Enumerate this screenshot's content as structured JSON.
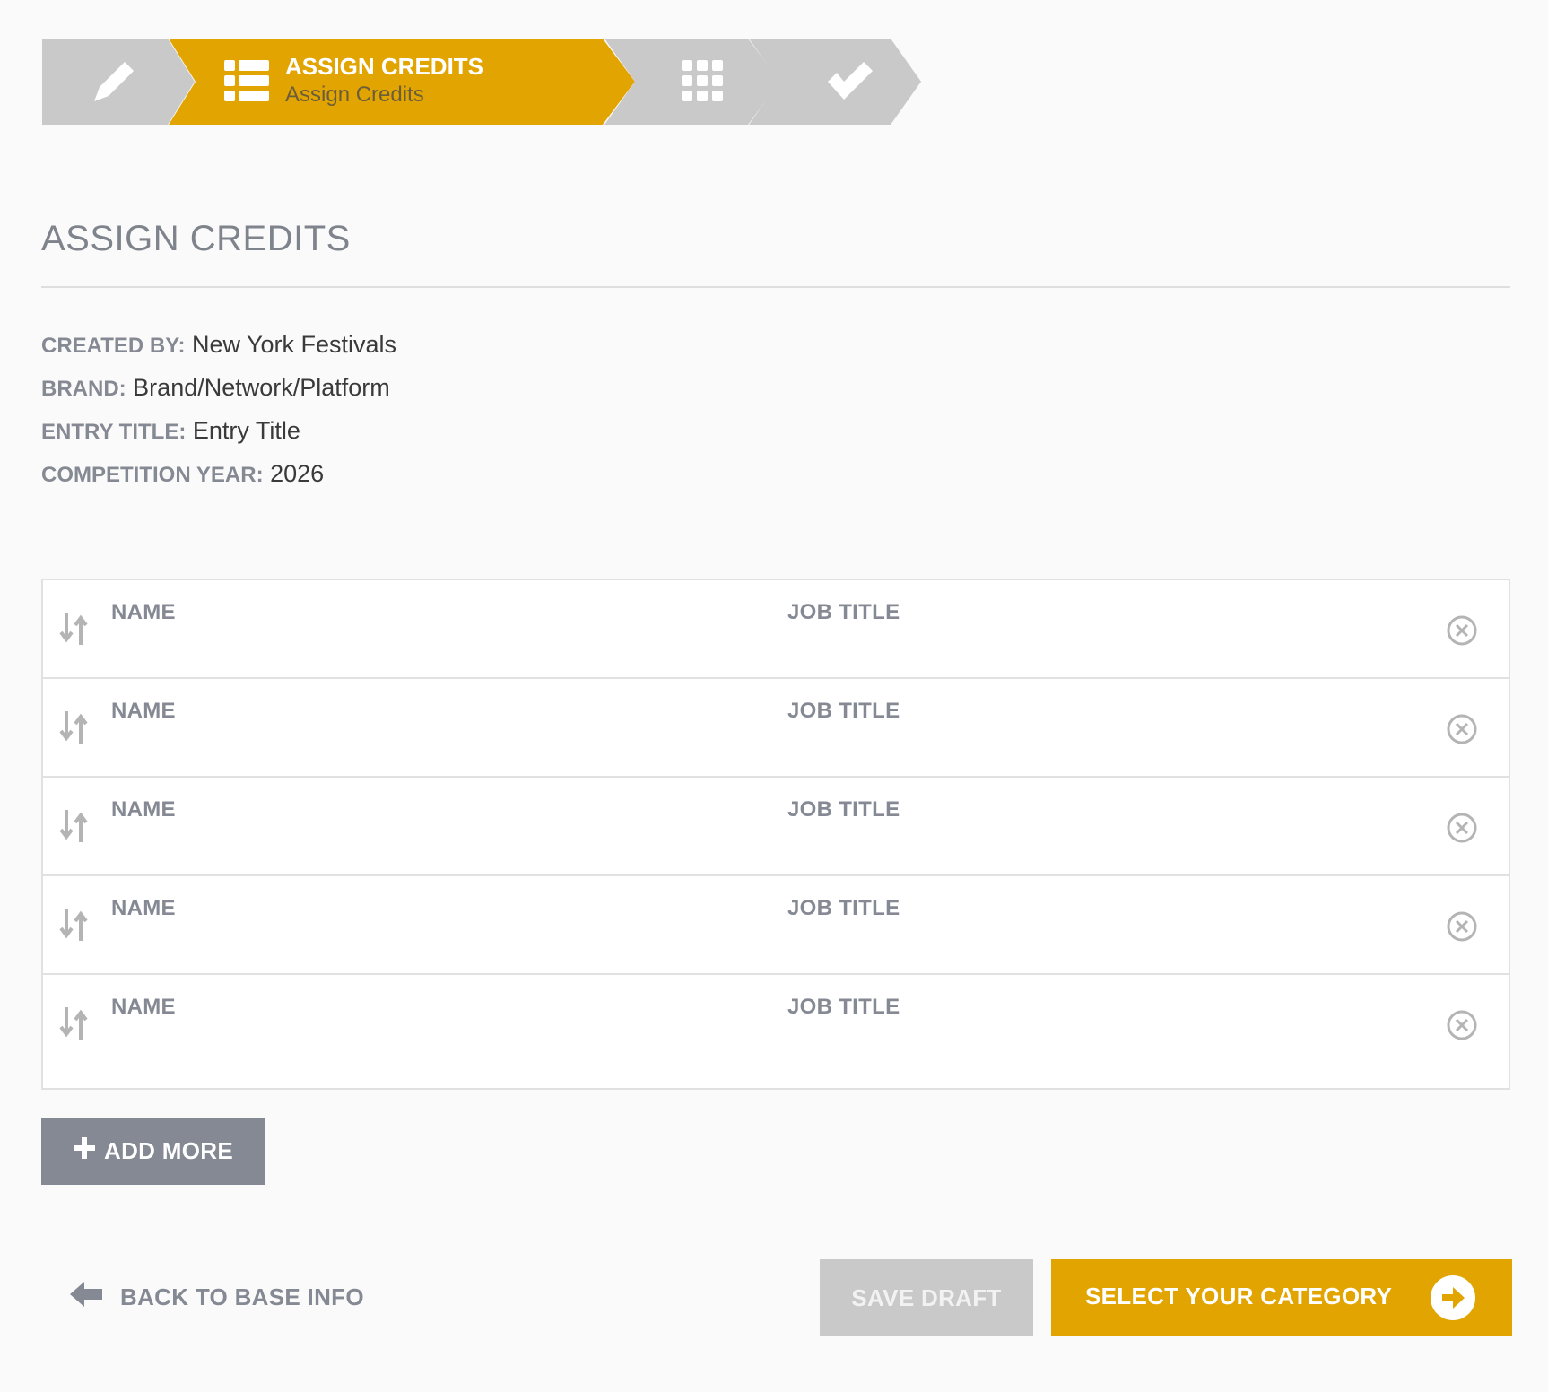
{
  "wizard": {
    "active_title": "ASSIGN CREDITS",
    "active_subtitle": "Assign Credits",
    "steps": [
      "pencil-icon",
      "list-icon",
      "grid-icon",
      "check-icon"
    ],
    "active_color": "#e2a400",
    "inactive_color": "#c9c9c9"
  },
  "page": {
    "title": "ASSIGN CREDITS"
  },
  "meta": {
    "created_by_label": "CREATED BY:",
    "created_by_value": "New York Festivals",
    "brand_label": "BRAND:",
    "brand_value": "Brand/Network/Platform",
    "entry_title_label": "ENTRY TITLE:",
    "entry_title_value": "Entry Title",
    "year_label": "COMPETITION YEAR:",
    "year_value": "2026"
  },
  "credits": {
    "name_label": "NAME",
    "job_label": "JOB TITLE",
    "rows": [
      {
        "name": "",
        "job": ""
      },
      {
        "name": "",
        "job": ""
      },
      {
        "name": "",
        "job": ""
      },
      {
        "name": "",
        "job": ""
      },
      {
        "name": "",
        "job": ""
      }
    ]
  },
  "actions": {
    "add_more": "ADD MORE",
    "back": "BACK TO BASE INFO",
    "save_draft": "SAVE DRAFT",
    "next": "SELECT YOUR CATEGORY"
  }
}
